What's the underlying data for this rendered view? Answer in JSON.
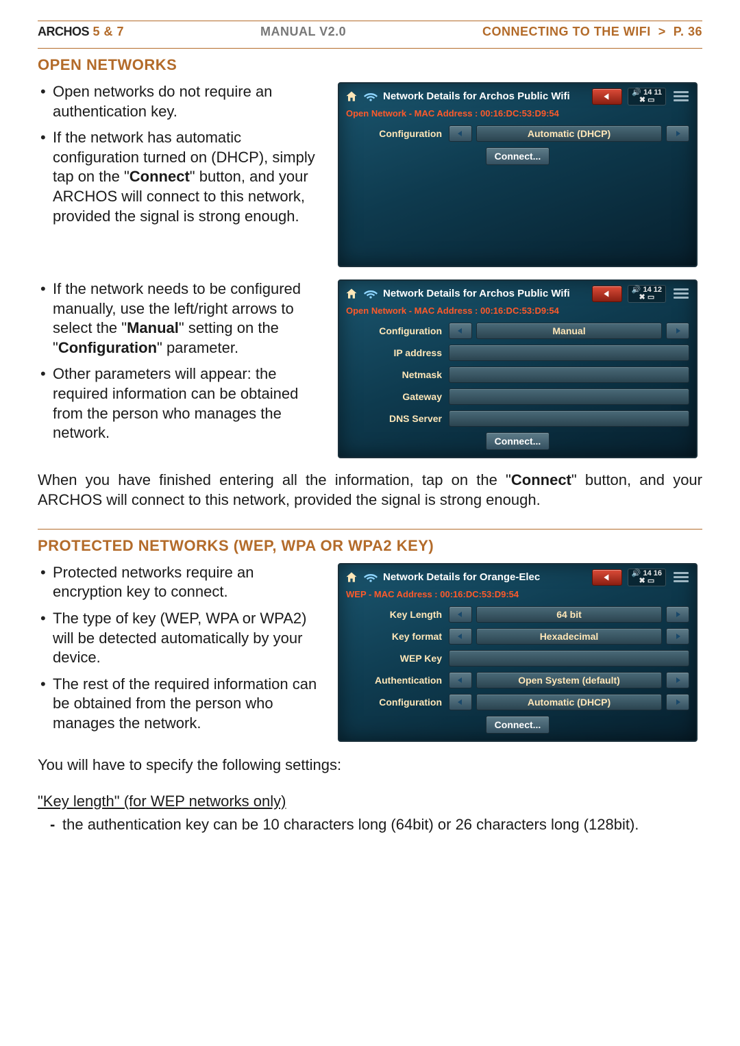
{
  "header": {
    "brand": "ARCHOS",
    "model": "5 & 7",
    "manual": "MANUAL V2.0",
    "right_section": "CONNECTING TO THE WIFI",
    "gt": ">",
    "page": "P. 36"
  },
  "section1_title": "OPEN NETWORKS",
  "section1_bullets_a": [
    "Open networks do not require an authentication key.",
    "If the network has automatic configuration turned on (DHCP), simply tap on the \"Connect\" button, and your ARCHOS will connect to this network, provided the signal is strong enough."
  ],
  "section1_bullets_b": [
    "If the network needs to be configured manually, use the left/right arrows to select the \"Manual\" setting on the \"Configuration\" parameter.",
    "Other parameters will appear: the required information can be obtained from the person who manages the network."
  ],
  "section1_bold": {
    "connect": "Connect",
    "manual": "Manual",
    "configuration": "Configuration"
  },
  "section1_tail": "When you have finished entering all the information, tap on the \"Connect\" button, and your ARCHOS will connect to this network, provided the signal is strong enough.",
  "section2_title": "PROTECTED NETWORKS (WEP, WPA OR WPA2 KEY)",
  "section2_bullets": [
    "Protected networks require an encryption key to connect.",
    "The type of key (WEP, WPA or WPA2) will be detected automatically by your device.",
    "The rest of the required information can be obtained from the person who manages the network."
  ],
  "section2_tail": "You will have to specify the following settings:",
  "keylength_intro": "\"Key length\" (for WEP networks only)",
  "keylength_item": "the authentication key can be 10 characters long (64bit) or 26 characters long (128bit).",
  "dev1": {
    "title": "Network Details for Archos Public Wifi",
    "time": "14 11",
    "sub": "Open Network - MAC Address : 00:16:DC:53:D9:54",
    "rows": [
      {
        "label": "Configuration",
        "value": "Automatic (DHCP)",
        "arrows": true
      }
    ],
    "connect": "Connect..."
  },
  "dev2": {
    "title": "Network Details for Archos Public Wifi",
    "time": "14 12",
    "sub": "Open Network - MAC Address : 00:16:DC:53:D9:54",
    "rows": [
      {
        "label": "Configuration",
        "value": "Manual",
        "arrows": true
      },
      {
        "label": "IP address",
        "value": "",
        "arrows": false
      },
      {
        "label": "Netmask",
        "value": "",
        "arrows": false
      },
      {
        "label": "Gateway",
        "value": "",
        "arrows": false
      },
      {
        "label": "DNS Server",
        "value": "",
        "arrows": false
      }
    ],
    "connect": "Connect..."
  },
  "dev3": {
    "title": "Network Details for Orange-Elec",
    "time": "14 16",
    "sub": "WEP - MAC Address : 00:16:DC:53:D9:54",
    "rows": [
      {
        "label": "Key Length",
        "value": "64 bit",
        "arrows": true
      },
      {
        "label": "Key format",
        "value": "Hexadecimal",
        "arrows": true
      },
      {
        "label": "WEP Key",
        "value": "",
        "arrows": false
      },
      {
        "label": "Authentication",
        "value": "Open System (default)",
        "arrows": true
      },
      {
        "label": "Configuration",
        "value": "Automatic (DHCP)",
        "arrows": true
      }
    ],
    "connect": "Connect..."
  }
}
